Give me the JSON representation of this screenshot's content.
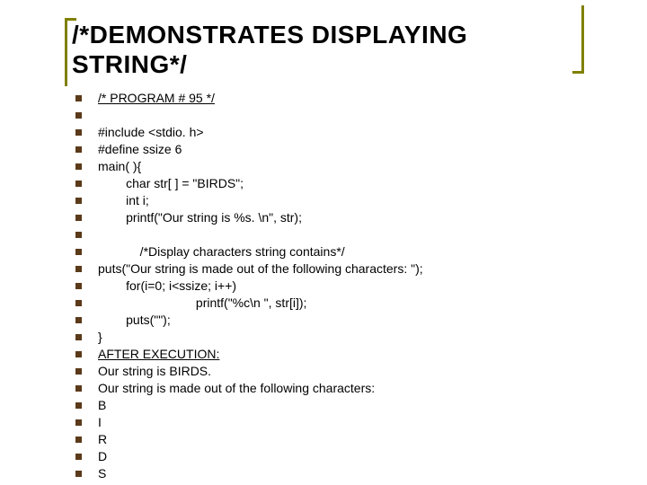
{
  "title": "/*DEMONSTRATES DISPLAYING STRING*/",
  "lines": [
    {
      "text": "/* PROGRAM # 95 */",
      "underline": true
    },
    {
      "text": "",
      "blank": true
    },
    {
      "text": "#include <stdio. h>"
    },
    {
      "text": "#define ssize 6"
    },
    {
      "text": "main( ){"
    },
    {
      "text": "        char str[ ] = \"BIRDS\";"
    },
    {
      "text": "        int i;"
    },
    {
      "text": "        printf(\"Our string is %s. \\n\", str);"
    },
    {
      "text": "",
      "blank": true
    },
    {
      "text": "            /*Display characters string contains*/"
    },
    {
      "text": "puts(\"Our string is made out of the following characters: \");"
    },
    {
      "text": "        for(i=0; i<ssize; i++)"
    },
    {
      "text": "                            printf(\"%c\\n \", str[i]);"
    },
    {
      "text": "        puts(\"\");"
    },
    {
      "text": "}"
    },
    {
      "text": "AFTER EXECUTION:",
      "underline": true
    },
    {
      "text": "Our string is BIRDS."
    },
    {
      "text": "Our string is made out of the following characters:"
    },
    {
      "text": "B"
    },
    {
      "text": "I"
    },
    {
      "text": "R"
    },
    {
      "text": "D"
    },
    {
      "text": "S"
    }
  ]
}
